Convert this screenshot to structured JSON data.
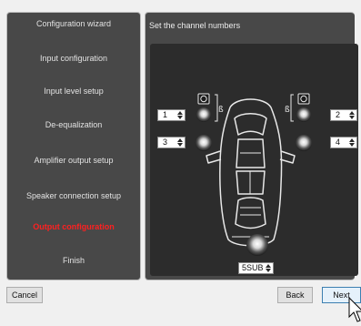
{
  "wizard": {
    "steps": [
      {
        "label": "Configuration wizard",
        "active": false
      },
      {
        "label": "Input configuration",
        "active": false
      },
      {
        "label": "Input level setup",
        "active": false
      },
      {
        "label": "De-equalization",
        "active": false
      },
      {
        "label": "Amplifier output setup",
        "active": false
      },
      {
        "label": "Speaker connection setup",
        "active": false
      },
      {
        "label": "Output configuration",
        "active": true
      },
      {
        "label": "Finish",
        "active": false
      }
    ]
  },
  "content": {
    "title": "Set the channel numbers",
    "channels": {
      "front_left": "1",
      "front_right": "2",
      "rear_left": "3",
      "rear_right": "4",
      "subwoofer": "5SUB"
    }
  },
  "footer": {
    "cancel_label": "Cancel",
    "back_label": "Back",
    "next_label": "Next"
  },
  "colors": {
    "active_step": "#ff2020",
    "panel": "#484848",
    "stage": "#2c2c2c"
  }
}
